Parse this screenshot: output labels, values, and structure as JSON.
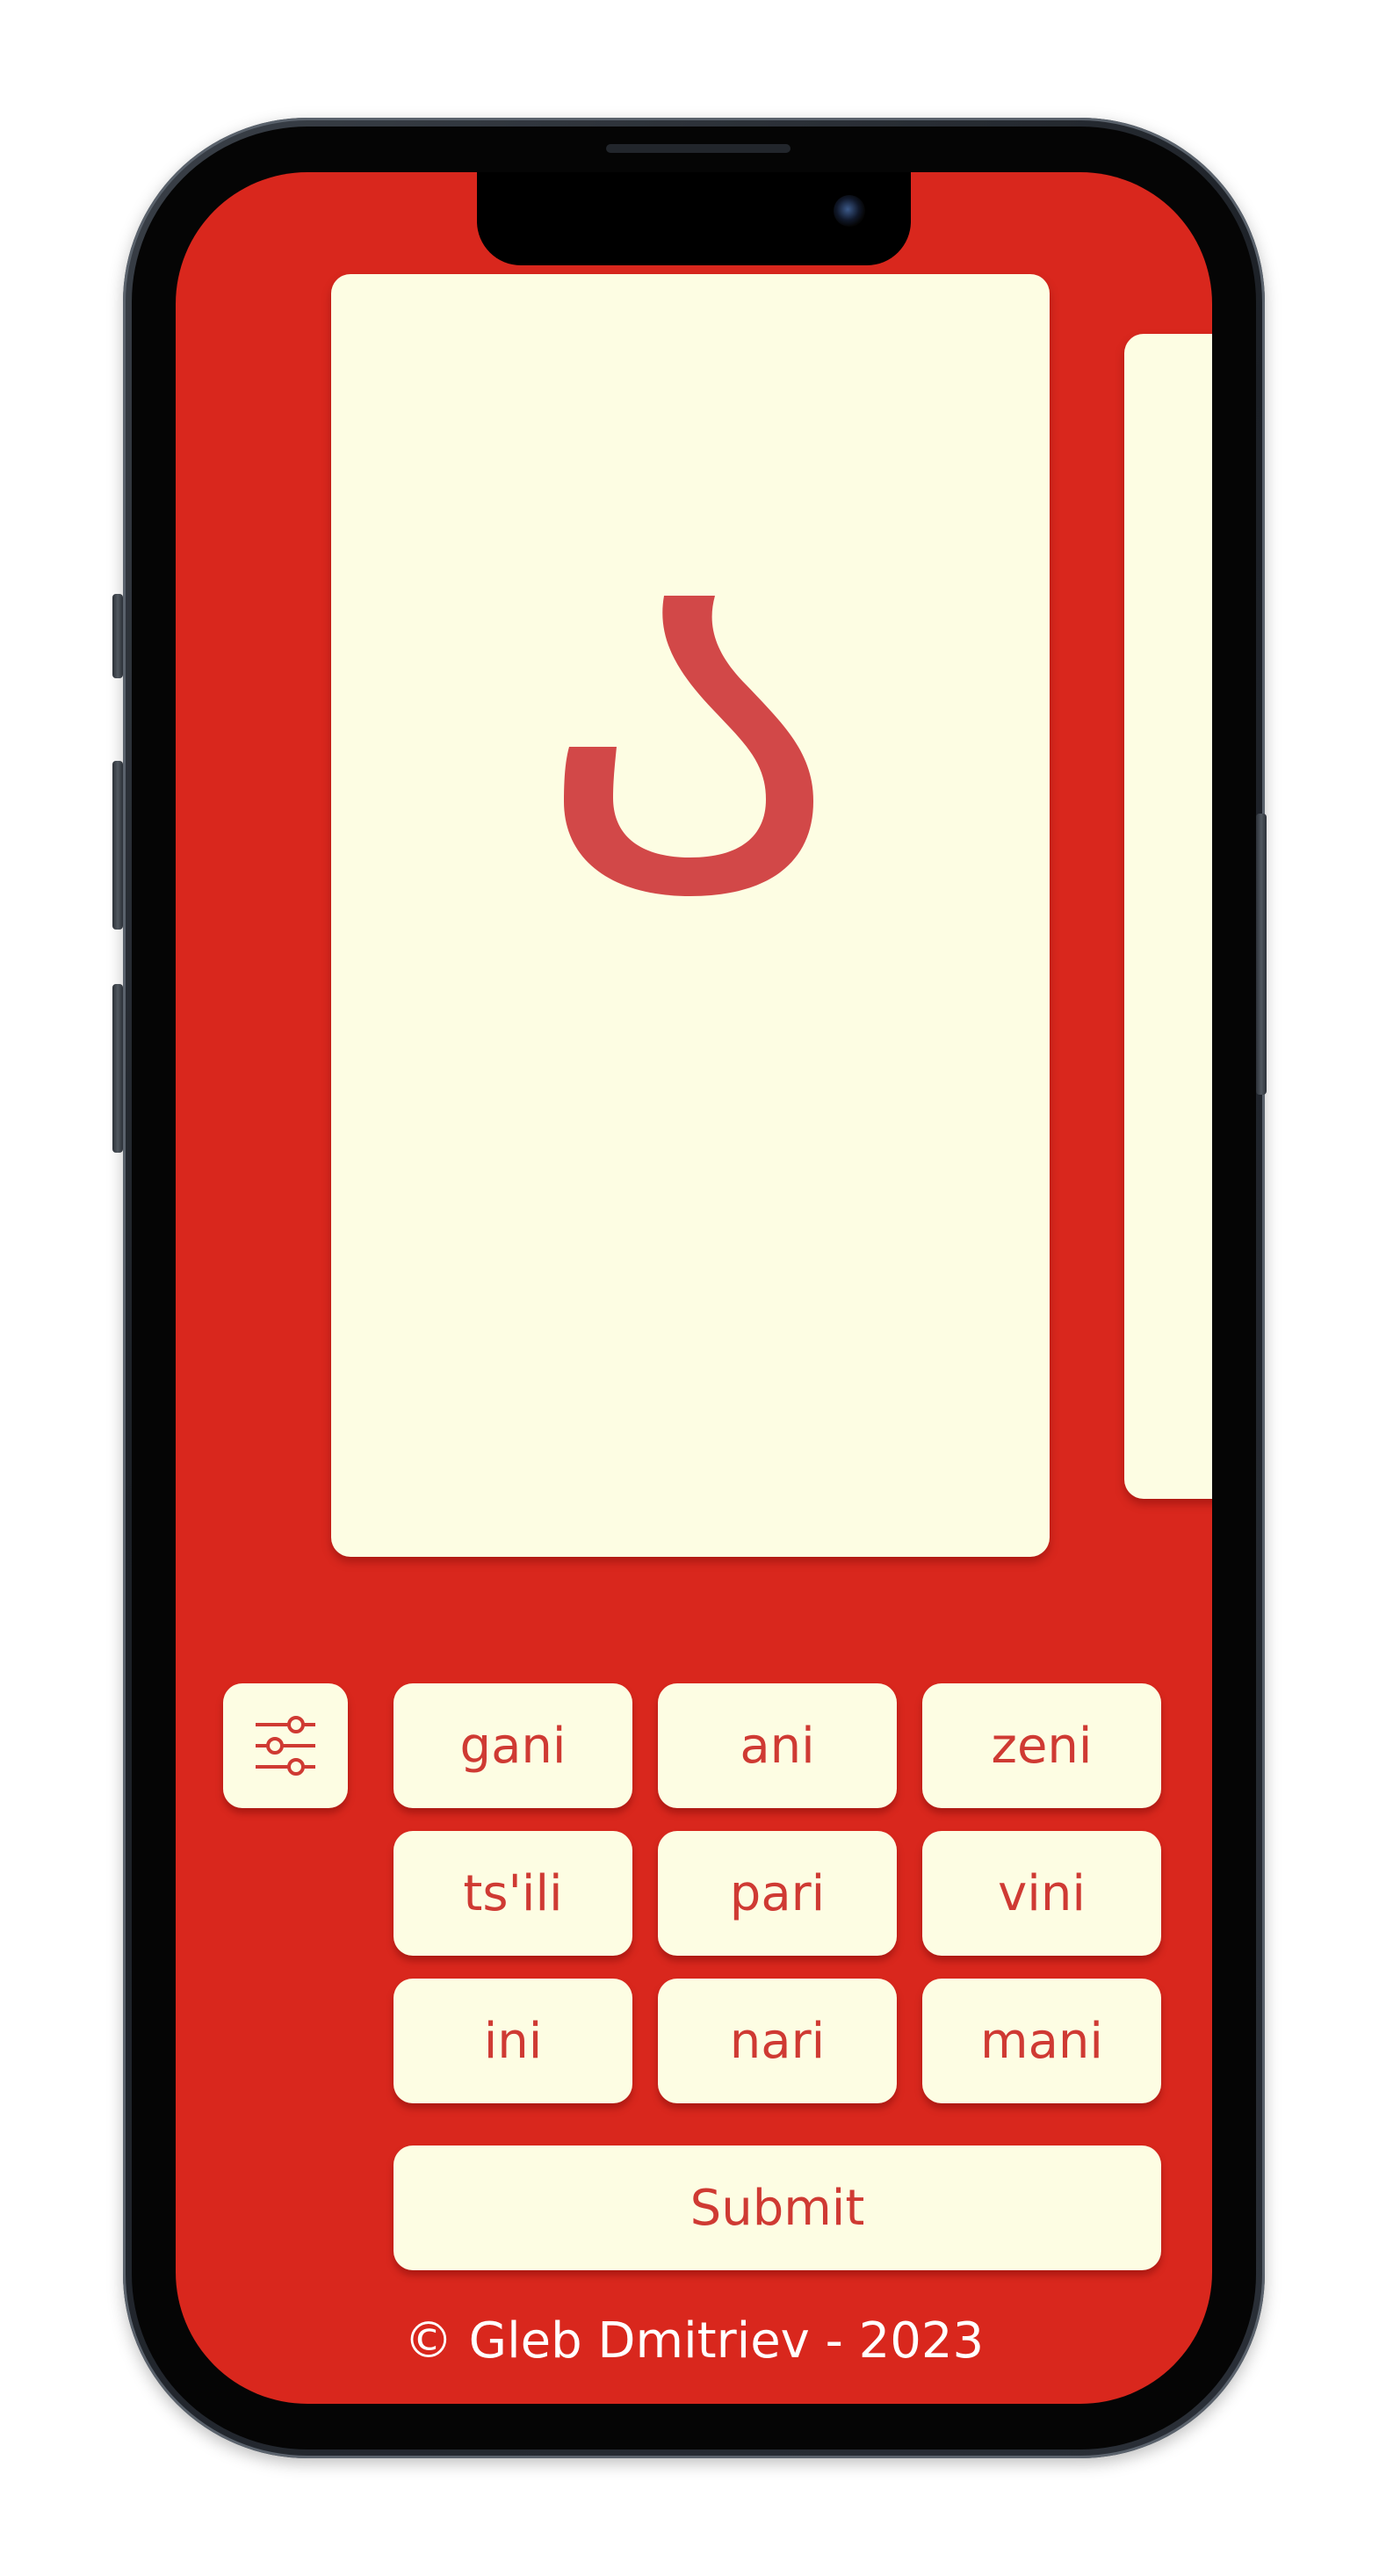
{
  "card": {
    "letter": "ა"
  },
  "settings": {
    "icon": "sliders-icon"
  },
  "options": [
    {
      "label": "gani"
    },
    {
      "label": "ani"
    },
    {
      "label": "zeni"
    },
    {
      "label": "ts'ili"
    },
    {
      "label": "pari"
    },
    {
      "label": "vini"
    },
    {
      "label": "ini"
    },
    {
      "label": "nari"
    },
    {
      "label": "mani"
    }
  ],
  "submit_label": "Submit",
  "footer_text": "© Gleb Dmitriev - 2023",
  "colors": {
    "background": "#d9271d",
    "card": "#fdfde3",
    "accent": "#cf3a33"
  }
}
